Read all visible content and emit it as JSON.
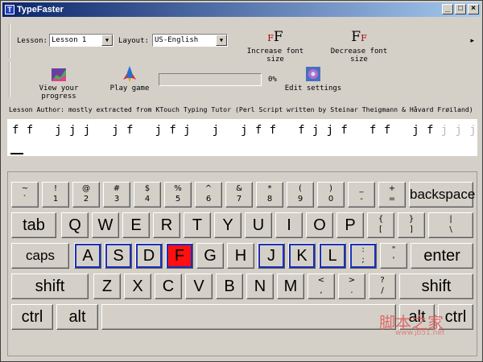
{
  "window": {
    "title": "TypeFaster",
    "minimize": "_",
    "maximize": "□",
    "close": "×"
  },
  "toolbar1": {
    "lesson_label": "Lesson:",
    "lesson_value": "Lesson 1",
    "layout_label": "Layout:",
    "layout_value": "US-English",
    "increase_label": "Increase font size",
    "decrease_label": "Decrease font size",
    "more": "▸"
  },
  "toolbar2": {
    "progress_label": "View your progress",
    "game_label": "Play game",
    "progress_percent": "0%",
    "progress_value": 0,
    "settings_label": "Edit settings"
  },
  "author_text": "Lesson Author: mostly extracted from KTouch Typing Tutor (Perl Script written by Steinar Theigmann & Håvard Frøiland)",
  "lesson_text_typed": "f f   j j j   j f   j f j   j   j f f   f j j f   f f   j f",
  "lesson_text_rest": " j j j",
  "keyboard": {
    "row1": [
      {
        "top": "~",
        "bot": "`"
      },
      {
        "top": "!",
        "bot": "1"
      },
      {
        "top": "@",
        "bot": "2"
      },
      {
        "top": "#",
        "bot": "3"
      },
      {
        "top": "$",
        "bot": "4"
      },
      {
        "top": "%",
        "bot": "5"
      },
      {
        "top": "^",
        "bot": "6"
      },
      {
        "top": "&",
        "bot": "7"
      },
      {
        "top": "*",
        "bot": "8"
      },
      {
        "top": "(",
        "bot": "9"
      },
      {
        "top": ")",
        "bot": "0"
      },
      {
        "top": "_",
        "bot": "-"
      },
      {
        "top": "+",
        "bot": "="
      }
    ],
    "backspace": "backspace",
    "tab": "tab",
    "row2": [
      "Q",
      "W",
      "E",
      "R",
      "T",
      "Y",
      "U",
      "I",
      "O",
      "P"
    ],
    "row2_br1": {
      "top": "{",
      "bot": "["
    },
    "row2_br2": {
      "top": "}",
      "bot": "]"
    },
    "row2_bs": {
      "top": "|",
      "bot": "\\"
    },
    "capslock": "caps lock",
    "row3": [
      "A",
      "S",
      "D",
      "F",
      "G",
      "H",
      "J",
      "K",
      "L"
    ],
    "row3_semi": {
      "top": ":",
      "bot": ";"
    },
    "row3_quote": {
      "top": "\"",
      "bot": "'"
    },
    "enter": "enter",
    "shift_left": "shift",
    "row4": [
      "Z",
      "X",
      "C",
      "V",
      "B",
      "N",
      "M"
    ],
    "row4_comma": {
      "top": "<",
      "bot": ","
    },
    "row4_period": {
      "top": ">",
      "bot": "."
    },
    "row4_slash": {
      "top": "?",
      "bot": "/"
    },
    "shift_right": "shift",
    "ctrl_left": "ctrl",
    "alt_left": "alt",
    "alt_right": "alt",
    "ctrl_right": "ctrl",
    "active_key": "F",
    "home_keys": [
      "A",
      "S",
      "D",
      "F",
      "J",
      "K",
      "L",
      ";"
    ]
  },
  "watermark": "脚本之家",
  "watermark_url": "www.jb51.net"
}
